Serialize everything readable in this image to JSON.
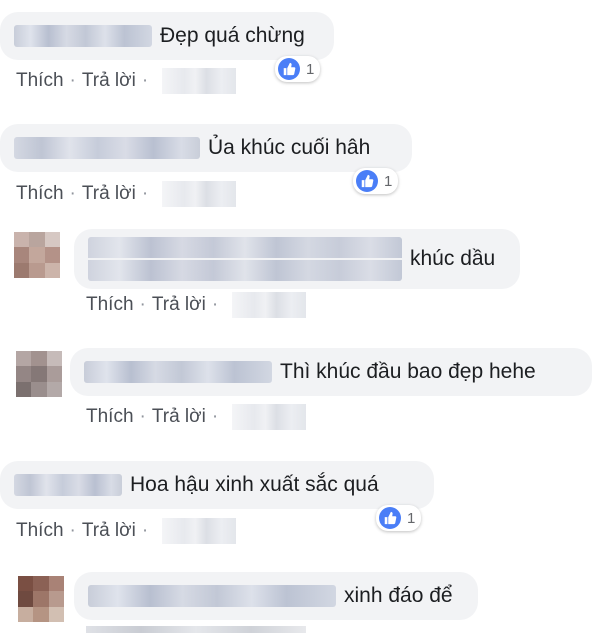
{
  "comments": [
    {
      "text": "Đẹp quá chừng",
      "actions": {
        "like": "Thích",
        "reply": "Trả lời",
        "sep": "·"
      },
      "reactions": {
        "count": "1",
        "icon": "thumbs-up-icon"
      }
    },
    {
      "text": "Ủa khúc cuối hâh",
      "actions": {
        "like": "Thích",
        "reply": "Trả lời",
        "sep": "·"
      },
      "reactions": {
        "count": "1",
        "icon": "thumbs-up-icon"
      }
    },
    {
      "text": "khúc dầu",
      "actions": {
        "like": "Thích",
        "reply": "Trả lời",
        "sep": "·"
      }
    },
    {
      "text": "Thì khúc đầu bao đẹp hehe",
      "actions": {
        "like": "Thích",
        "reply": "Trả lời",
        "sep": "·"
      }
    },
    {
      "text": "Hoa hậu xinh xuất sắc quá",
      "actions": {
        "like": "Thích",
        "reply": "Trả lời",
        "sep": "·"
      },
      "reactions": {
        "count": "1",
        "icon": "thumbs-up-icon"
      }
    },
    {
      "text": "xinh đáo để"
    }
  ],
  "colors": {
    "bubble": "#f2f3f5",
    "like_blue": "#4a7ef7",
    "action_text": "#4b4f56"
  }
}
